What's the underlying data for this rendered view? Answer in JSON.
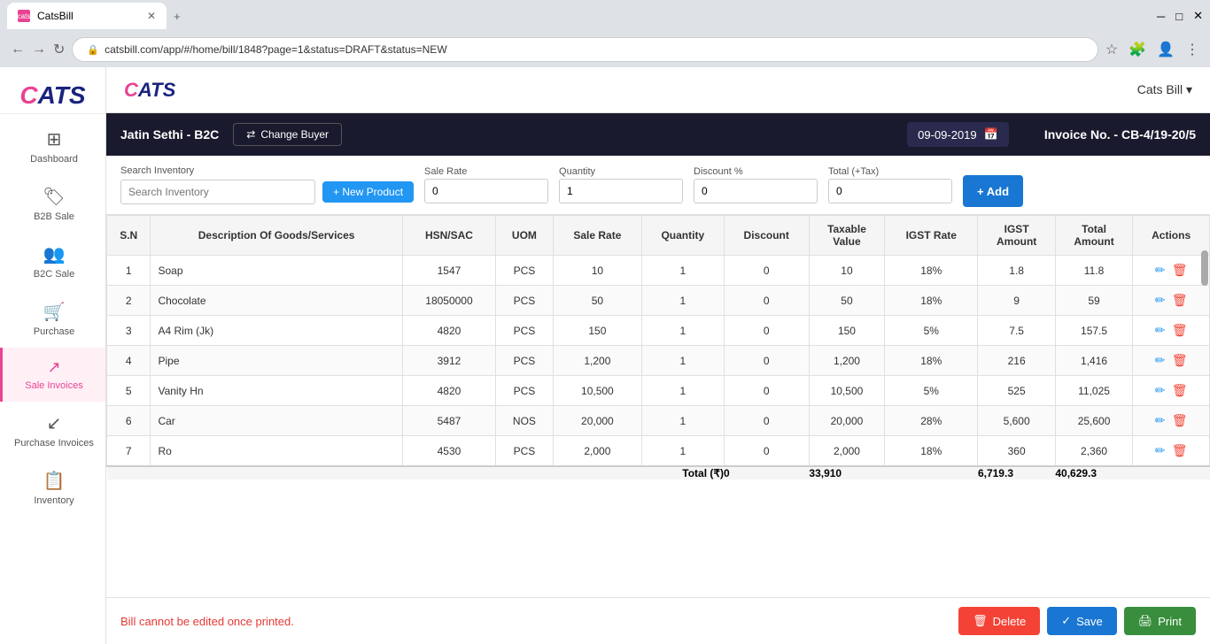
{
  "browser": {
    "tab_favicon": "cats",
    "tab_title": "CatsBill",
    "address": "catsbill.com/app/#/home/bill/1848?page=1&status=DRAFT&status=NEW"
  },
  "topbar": {
    "logo": "CATS",
    "app_name": "CatsBill",
    "cats_bill_label": "Cats Bill ▾"
  },
  "sidebar": {
    "items": [
      {
        "id": "dashboard",
        "label": "Dashboard",
        "icon": "⊞"
      },
      {
        "id": "b2b-sale",
        "label": "B2B Sale",
        "icon": "🏷"
      },
      {
        "id": "b2c-sale",
        "label": "B2C Sale",
        "icon": "👥"
      },
      {
        "id": "purchase",
        "label": "Purchase",
        "icon": "🛒"
      },
      {
        "id": "sale-invoices",
        "label": "Sale Invoices",
        "icon": "↗",
        "active": true
      },
      {
        "id": "purchase-invoices",
        "label": "Purchase Invoices",
        "icon": "↙"
      },
      {
        "id": "inventory",
        "label": "Inventory",
        "icon": "📋"
      }
    ]
  },
  "invoice": {
    "buyer_name": "Jatin Sethi - B2C",
    "change_buyer_label": "Change Buyer",
    "date": "09-09-2019",
    "invoice_no_label": "Invoice No. - CB-4/19-20/5",
    "search_label": "Search Inventory",
    "new_product_label": "+ New Product",
    "fields": {
      "sale_rate_label": "Sale Rate",
      "sale_rate_value": "0",
      "quantity_label": "Quantity",
      "quantity_value": "1",
      "discount_label": "Discount %",
      "discount_value": "0",
      "total_label": "Total (+Tax)",
      "total_value": "0"
    },
    "add_label": "+ Add",
    "table": {
      "headers": [
        "S.N",
        "Description Of Goods/Services",
        "HSN/SAC",
        "UOM",
        "Sale Rate",
        "Quantity",
        "Discount",
        "Taxable Value",
        "IGST Rate",
        "IGST Amount",
        "Total Amount",
        "Actions"
      ],
      "rows": [
        {
          "sn": 1,
          "desc": "Soap",
          "hsn": "1547",
          "uom": "PCS",
          "sale_rate": "10",
          "qty": "1",
          "discount": "0",
          "taxable": "10",
          "igst_rate": "18%",
          "igst_amt": "1.8",
          "total": "11.8"
        },
        {
          "sn": 2,
          "desc": "Chocolate",
          "hsn": "18050000",
          "uom": "PCS",
          "sale_rate": "50",
          "qty": "1",
          "discount": "0",
          "taxable": "50",
          "igst_rate": "18%",
          "igst_amt": "9",
          "total": "59"
        },
        {
          "sn": 3,
          "desc": "A4 Rim (Jk)",
          "hsn": "4820",
          "uom": "PCS",
          "sale_rate": "150",
          "qty": "1",
          "discount": "0",
          "taxable": "150",
          "igst_rate": "5%",
          "igst_amt": "7.5",
          "total": "157.5"
        },
        {
          "sn": 4,
          "desc": "Pipe",
          "hsn": "3912",
          "uom": "PCS",
          "sale_rate": "1,200",
          "qty": "1",
          "discount": "0",
          "taxable": "1,200",
          "igst_rate": "18%",
          "igst_amt": "216",
          "total": "1,416"
        },
        {
          "sn": 5,
          "desc": "Vanity Hn",
          "hsn": "4820",
          "uom": "PCS",
          "sale_rate": "10,500",
          "qty": "1",
          "discount": "0",
          "taxable": "10,500",
          "igst_rate": "5%",
          "igst_amt": "525",
          "total": "11,025"
        },
        {
          "sn": 6,
          "desc": "Car",
          "hsn": "5487",
          "uom": "NOS",
          "sale_rate": "20,000",
          "qty": "1",
          "discount": "0",
          "taxable": "20,000",
          "igst_rate": "28%",
          "igst_amt": "5,600",
          "total": "25,600"
        },
        {
          "sn": 7,
          "desc": "Ro",
          "hsn": "4530",
          "uom": "PCS",
          "sale_rate": "2,000",
          "qty": "1",
          "discount": "0",
          "taxable": "2,000",
          "igst_rate": "18%",
          "igst_amt": "360",
          "total": "2,360"
        }
      ],
      "totals": {
        "label": "Total (₹)",
        "discount": "0",
        "taxable": "33,910",
        "igst_amt": "6,719.3",
        "total": "40,629.3"
      }
    },
    "footer": {
      "warning": "Bill cannot be edited once printed.",
      "delete_label": "Delete",
      "save_label": "Save",
      "print_label": "Print"
    }
  }
}
